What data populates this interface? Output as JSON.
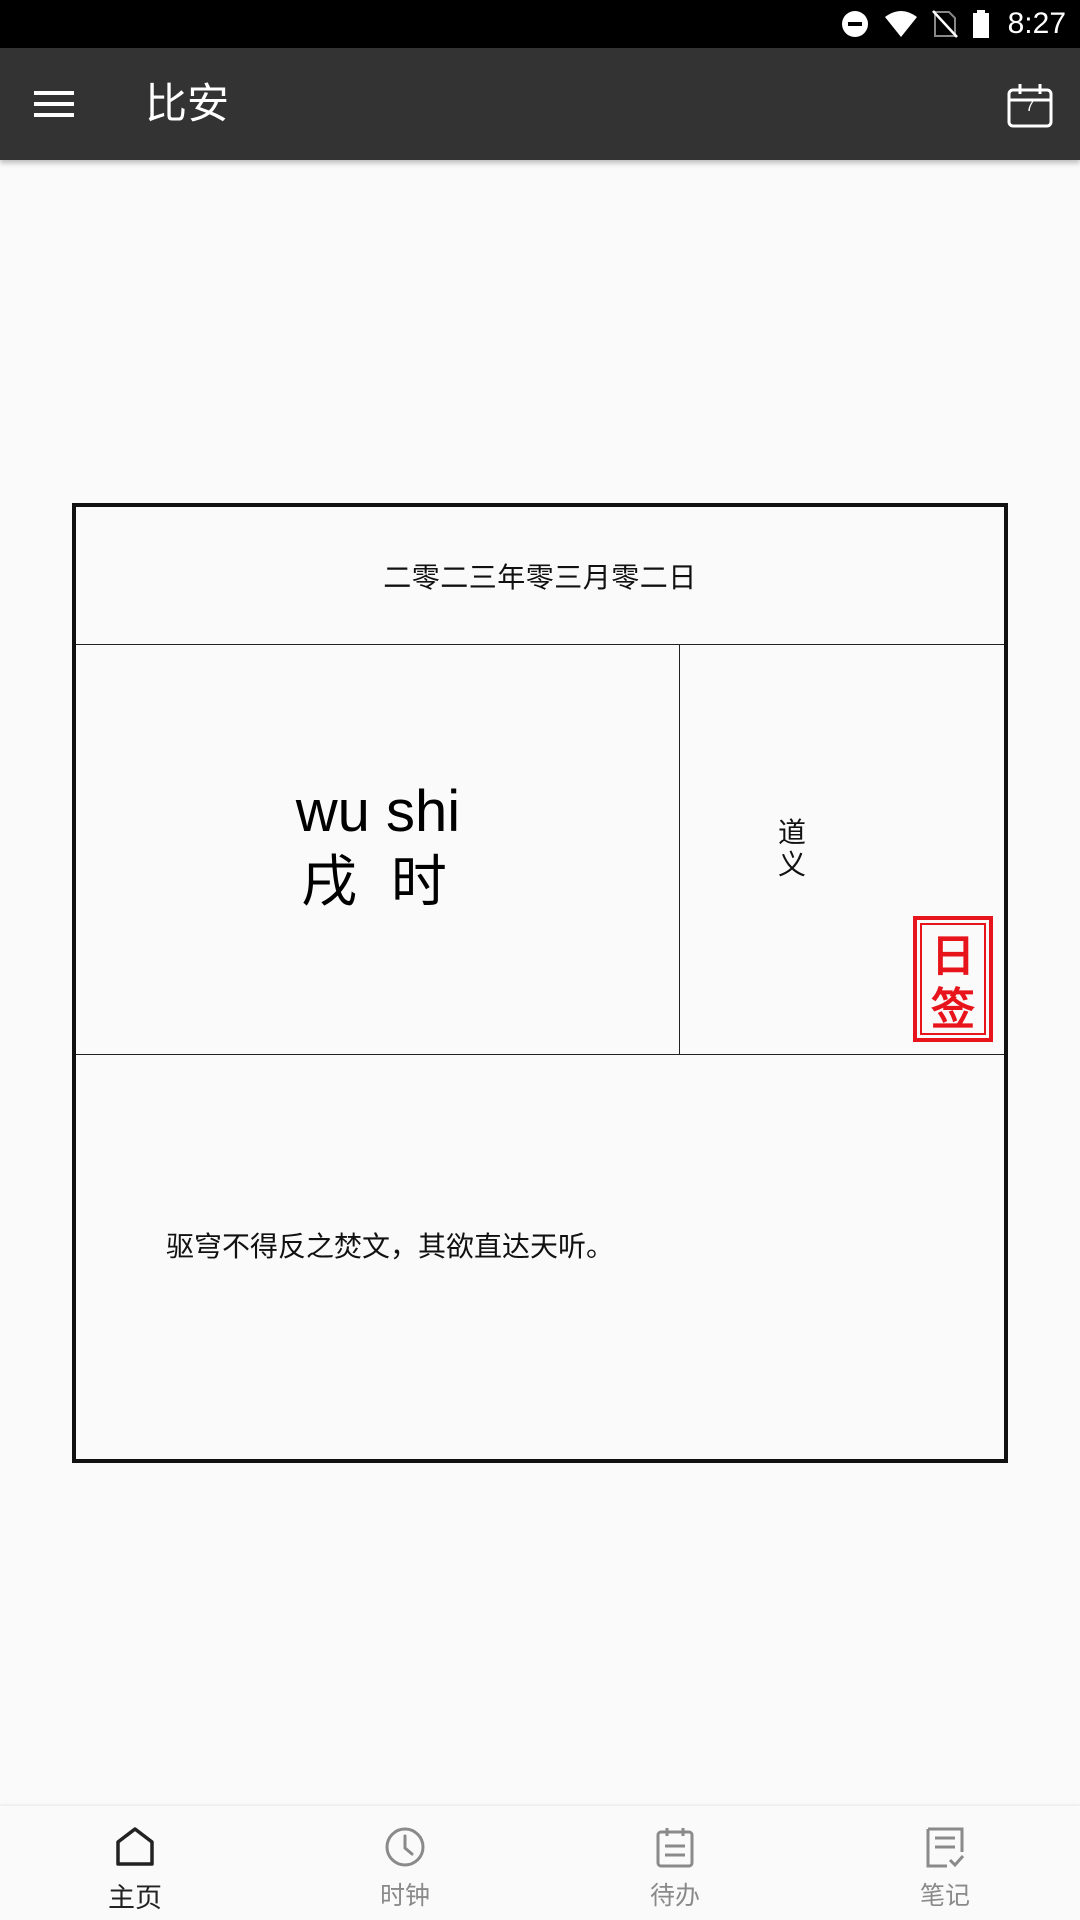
{
  "status_bar": {
    "time": "8:27",
    "icons": [
      "do-not-disturb-icon",
      "wifi-icon",
      "no-sim-icon",
      "battery-icon"
    ]
  },
  "app_bar": {
    "title": "比安",
    "calendar_day": "7",
    "icons": [
      "menu-icon",
      "calendar-icon"
    ]
  },
  "card": {
    "date": "二零二三年零三月零二日",
    "hour_pinyin": "wu shi",
    "hour_name": "戌 时",
    "meaning": [
      "道",
      "义"
    ],
    "stamp": [
      "日",
      "签"
    ],
    "quote": "驱穹不得反之焚文，其欲直达天听。"
  },
  "bottom_nav": {
    "items": [
      {
        "label": "主页",
        "icon": "home-icon",
        "active": true
      },
      {
        "label": "时钟",
        "icon": "clock-icon",
        "active": false
      },
      {
        "label": "待办",
        "icon": "todo-icon",
        "active": false
      },
      {
        "label": "笔记",
        "icon": "notes-icon",
        "active": false
      }
    ]
  },
  "colors": {
    "app_bar": "#333333",
    "stamp_red": "#e8141c",
    "background": "#fafafa",
    "nav_active": "#222222",
    "nav_inactive": "#8a8a8a"
  }
}
